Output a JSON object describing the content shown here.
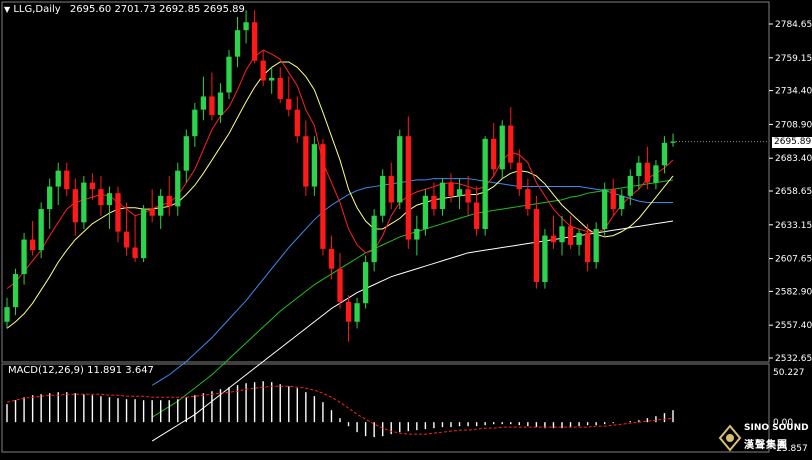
{
  "header": {
    "menu_arrow": "▼",
    "symbol": "LLG,Daily",
    "ohlc": "2695.60 2701.73 2692.85 2695.89"
  },
  "price_axis": {
    "ticks": [
      "2784.65",
      "2759.15",
      "2734.40",
      "2708.90",
      "2683.40",
      "2658.65",
      "2633.15",
      "2607.65",
      "2582.90",
      "2557.40",
      "2532.65"
    ],
    "current": "2695.89"
  },
  "macd": {
    "label": "MACD(12,26,9) 11.891 3.647",
    "ticks": [
      "50.227",
      "0.00",
      "-25.857"
    ]
  },
  "logo": {
    "name": "SINO SOUND",
    "chinese": "漢聲集團"
  },
  "colors": {
    "bull": "#2bd44a",
    "bear": "#ff1a1a",
    "ma_fast": "#ff2020",
    "ma_mid": "#ffff80",
    "ma_blue": "#3c8cf0",
    "ma_green": "#20c020",
    "ma_white": "#ffffff",
    "macd_bar": "#ffffff",
    "macd_signal": "#ff2020",
    "grid": "#808080"
  },
  "chart_data": {
    "type": "candlestick",
    "y_range": [
      2532.65,
      2784.65
    ],
    "macd_range": [
      -25.857,
      50.227
    ],
    "candles": [
      [
        2560,
        2578,
        2555,
        2571
      ],
      [
        2571,
        2600,
        2565,
        2596
      ],
      [
        2596,
        2627,
        2588,
        2622
      ],
      [
        2622,
        2636,
        2610,
        2614
      ],
      [
        2614,
        2650,
        2608,
        2645
      ],
      [
        2645,
        2668,
        2630,
        2662
      ],
      [
        2662,
        2680,
        2648,
        2674
      ],
      [
        2674,
        2680,
        2655,
        2660
      ],
      [
        2660,
        2668,
        2625,
        2635
      ],
      [
        2635,
        2670,
        2630,
        2665
      ],
      [
        2665,
        2672,
        2652,
        2660
      ],
      [
        2660,
        2670,
        2640,
        2648
      ],
      [
        2648,
        2662,
        2630,
        2657
      ],
      [
        2657,
        2662,
        2620,
        2628
      ],
      [
        2628,
        2650,
        2610,
        2616
      ],
      [
        2616,
        2640,
        2605,
        2608
      ],
      [
        2608,
        2648,
        2605,
        2645
      ],
      [
        2645,
        2660,
        2635,
        2640
      ],
      [
        2640,
        2660,
        2630,
        2655
      ],
      [
        2655,
        2670,
        2640,
        2647
      ],
      [
        2647,
        2680,
        2640,
        2674
      ],
      [
        2674,
        2705,
        2665,
        2700
      ],
      [
        2700,
        2725,
        2692,
        2720
      ],
      [
        2720,
        2745,
        2712,
        2730
      ],
      [
        2730,
        2748,
        2712,
        2716
      ],
      [
        2716,
        2740,
        2710,
        2733
      ],
      [
        2733,
        2765,
        2728,
        2760
      ],
      [
        2760,
        2790,
        2752,
        2780
      ],
      [
        2780,
        2795,
        2770,
        2786
      ],
      [
        2786,
        2795,
        2755,
        2757
      ],
      [
        2757,
        2765,
        2738,
        2742
      ],
      [
        2742,
        2752,
        2732,
        2744
      ],
      [
        2744,
        2752,
        2725,
        2728
      ],
      [
        2728,
        2745,
        2715,
        2720
      ],
      [
        2720,
        2730,
        2695,
        2700
      ],
      [
        2700,
        2712,
        2655,
        2662
      ],
      [
        2662,
        2700,
        2655,
        2694
      ],
      [
        2694,
        2698,
        2610,
        2615
      ],
      [
        2615,
        2625,
        2592,
        2600
      ],
      [
        2600,
        2612,
        2570,
        2575
      ],
      [
        2575,
        2580,
        2545,
        2560
      ],
      [
        2560,
        2578,
        2555,
        2574
      ],
      [
        2574,
        2610,
        2570,
        2605
      ],
      [
        2605,
        2645,
        2598,
        2640
      ],
      [
        2640,
        2675,
        2635,
        2670
      ],
      [
        2670,
        2680,
        2645,
        2650
      ],
      [
        2650,
        2705,
        2645,
        2700
      ],
      [
        2700,
        2715,
        2615,
        2622
      ],
      [
        2622,
        2640,
        2610,
        2630
      ],
      [
        2630,
        2660,
        2625,
        2655
      ],
      [
        2655,
        2665,
        2640,
        2645
      ],
      [
        2645,
        2668,
        2640,
        2665
      ],
      [
        2665,
        2672,
        2650,
        2655
      ],
      [
        2655,
        2668,
        2645,
        2660
      ],
      [
        2660,
        2670,
        2640,
        2650
      ],
      [
        2650,
        2662,
        2625,
        2630
      ],
      [
        2630,
        2700,
        2625,
        2698
      ],
      [
        2698,
        2710,
        2670,
        2675
      ],
      [
        2675,
        2712,
        2668,
        2708
      ],
      [
        2708,
        2722,
        2675,
        2680
      ],
      [
        2680,
        2690,
        2655,
        2660
      ],
      [
        2660,
        2668,
        2640,
        2645
      ],
      [
        2645,
        2655,
        2585,
        2590
      ],
      [
        2590,
        2630,
        2585,
        2625
      ],
      [
        2625,
        2640,
        2615,
        2620
      ],
      [
        2620,
        2640,
        2610,
        2632
      ],
      [
        2632,
        2640,
        2615,
        2618
      ],
      [
        2618,
        2630,
        2610,
        2627
      ],
      [
        2627,
        2634,
        2598,
        2605
      ],
      [
        2605,
        2635,
        2600,
        2630
      ],
      [
        2630,
        2665,
        2625,
        2660
      ],
      [
        2660,
        2668,
        2640,
        2645
      ],
      [
        2645,
        2660,
        2640,
        2655
      ],
      [
        2655,
        2675,
        2648,
        2670
      ],
      [
        2670,
        2685,
        2660,
        2680
      ],
      [
        2680,
        2692,
        2660,
        2665
      ],
      [
        2665,
        2682,
        2660,
        2678
      ],
      [
        2678,
        2700,
        2672,
        2695
      ],
      [
        2695,
        2702,
        2692,
        2696
      ]
    ],
    "ma_fast": [
      2585,
      2590,
      2598,
      2606,
      2614,
      2625,
      2635,
      2645,
      2650,
      2652,
      2654,
      2656,
      2655,
      2650,
      2645,
      2640,
      2642,
      2645,
      2648,
      2650,
      2655,
      2665,
      2675,
      2690,
      2705,
      2715,
      2722,
      2735,
      2750,
      2760,
      2765,
      2762,
      2758,
      2748,
      2738,
      2720,
      2708,
      2680,
      2665,
      2650,
      2630,
      2618,
      2612,
      2614,
      2625,
      2640,
      2650,
      2655,
      2658,
      2660,
      2662,
      2664,
      2665,
      2664,
      2662,
      2660,
      2662,
      2670,
      2682,
      2688,
      2686,
      2680,
      2665,
      2655,
      2645,
      2638,
      2632,
      2630,
      2628,
      2627,
      2630,
      2640,
      2648,
      2655,
      2660,
      2668,
      2672,
      2676,
      2682
    ],
    "ma_mid": [
      2555,
      2560,
      2566,
      2574,
      2584,
      2594,
      2605,
      2614,
      2622,
      2628,
      2634,
      2638,
      2642,
      2645,
      2646,
      2646,
      2645,
      2645,
      2646,
      2647,
      2650,
      2656,
      2663,
      2672,
      2682,
      2692,
      2702,
      2714,
      2726,
      2737,
      2746,
      2752,
      2756,
      2756,
      2752,
      2745,
      2735,
      2718,
      2700,
      2682,
      2660,
      2646,
      2636,
      2630,
      2630,
      2634,
      2638,
      2644,
      2648,
      2650,
      2652,
      2653,
      2654,
      2655,
      2656,
      2656,
      2658,
      2662,
      2668,
      2672,
      2674,
      2673,
      2670,
      2664,
      2656,
      2648,
      2642,
      2636,
      2630,
      2626,
      2624,
      2625,
      2628,
      2632,
      2638,
      2646,
      2654,
      2662,
      2670
    ],
    "ma_blue": [
      2512,
      2516,
      2520,
      2525,
      2530,
      2536,
      2542,
      2548,
      2555,
      2562,
      2569,
      2576,
      2584,
      2592,
      2600,
      2608,
      2616,
      2623,
      2630,
      2637,
      2643,
      2648,
      2652,
      2656,
      2659,
      2661,
      2662,
      2663,
      2664,
      2665,
      2666,
      2667,
      2667,
      2668,
      2668,
      2668,
      2668,
      2668,
      2667,
      2666,
      2665,
      2664,
      2663,
      2662,
      2662,
      2662,
      2662,
      2662,
      2662,
      2662,
      2662,
      2661,
      2660,
      2659,
      2657,
      2655,
      2653,
      2651,
      2650,
      2650,
      2650,
      2650
    ],
    "ma_green": [
      2488,
      2492,
      2496,
      2500,
      2505,
      2510,
      2515,
      2520,
      2526,
      2532,
      2538,
      2544,
      2550,
      2556,
      2562,
      2568,
      2573,
      2578,
      2583,
      2588,
      2592,
      2596,
      2600,
      2604,
      2608,
      2612,
      2615,
      2618,
      2621,
      2624,
      2626,
      2628,
      2630,
      2632,
      2634,
      2636,
      2638,
      2640,
      2642,
      2643,
      2644,
      2645,
      2646,
      2647,
      2648,
      2649,
      2650,
      2651,
      2652,
      2654,
      2655,
      2657,
      2658,
      2659,
      2660,
      2661,
      2662,
      2663,
      2664,
      2665,
      2666,
      2667
    ],
    "ma_white": [
      2470,
      2474,
      2478,
      2482,
      2486,
      2490,
      2495,
      2500,
      2505,
      2510,
      2515,
      2520,
      2525,
      2530,
      2535,
      2540,
      2545,
      2550,
      2555,
      2560,
      2565,
      2570,
      2574,
      2578,
      2582,
      2585,
      2588,
      2591,
      2594,
      2596,
      2598,
      2600,
      2602,
      2604,
      2606,
      2608,
      2610,
      2612,
      2613,
      2614,
      2615,
      2616,
      2617,
      2618,
      2619,
      2620,
      2621,
      2622,
      2623,
      2624,
      2625,
      2626,
      2627,
      2628,
      2629,
      2630,
      2631,
      2632,
      2633,
      2634,
      2635,
      2636
    ],
    "macd_hist": [
      18,
      22,
      25,
      27,
      28,
      29,
      30,
      30,
      29,
      28,
      27,
      26,
      25,
      24,
      23,
      23,
      22,
      22,
      22,
      22,
      23,
      25,
      27,
      29,
      31,
      33,
      35,
      37,
      39,
      40,
      41,
      40,
      38,
      36,
      34,
      30,
      26,
      20,
      12,
      4,
      -4,
      -10,
      -14,
      -15,
      -14,
      -12,
      -10,
      -9,
      -8,
      -7,
      -6,
      -5,
      -5,
      -4,
      -4,
      -4,
      -3,
      -2,
      -2,
      -2,
      -3,
      -4,
      -5,
      -6,
      -6,
      -6,
      -5,
      -4,
      -3,
      -3,
      -2,
      -1,
      0,
      1,
      2,
      4,
      6,
      9,
      12
    ],
    "macd_signal": [
      20,
      22,
      24,
      25,
      26,
      27,
      27,
      28,
      28,
      28,
      28,
      28,
      27,
      27,
      26,
      26,
      26,
      25,
      25,
      25,
      25,
      25,
      26,
      27,
      28,
      29,
      30,
      31,
      33,
      34,
      35,
      36,
      36,
      36,
      35,
      34,
      32,
      29,
      25,
      20,
      14,
      8,
      3,
      -2,
      -6,
      -9,
      -11,
      -12,
      -12,
      -12,
      -11,
      -10,
      -9,
      -8,
      -8,
      -7,
      -6,
      -6,
      -5,
      -5,
      -5,
      -5,
      -5,
      -5,
      -5,
      -5,
      -5,
      -5,
      -5,
      -4,
      -4,
      -3,
      -2,
      -1,
      0,
      1,
      2,
      3,
      4
    ]
  }
}
